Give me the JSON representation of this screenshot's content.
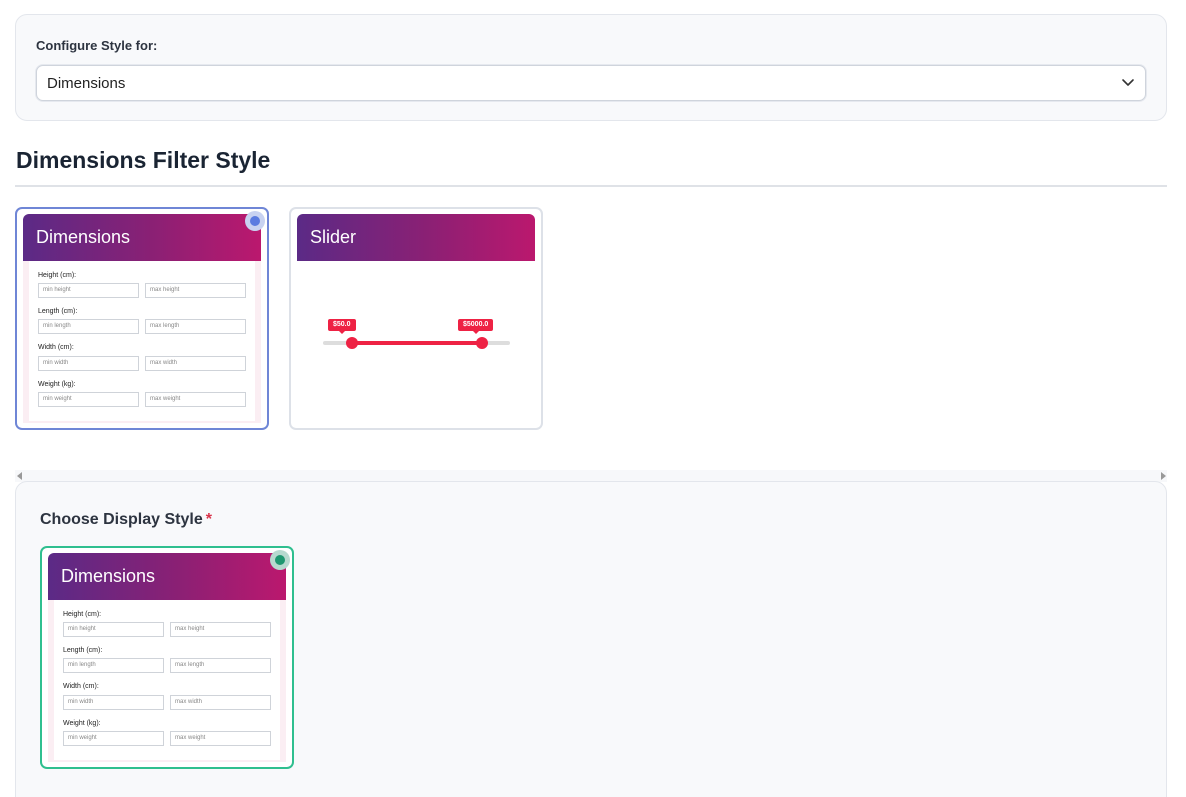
{
  "config": {
    "label": "Configure Style for:",
    "selected_value": "Dimensions"
  },
  "section": {
    "title": "Dimensions Filter Style"
  },
  "filter_styles": [
    {
      "title": "Dimensions",
      "fields": [
        {
          "label": "Height (cm):",
          "min": "min height",
          "max": "max height"
        },
        {
          "label": "Length (cm):",
          "min": "min length",
          "max": "max length"
        },
        {
          "label": "Width (cm):",
          "min": "min width",
          "max": "max width"
        },
        {
          "label": "Weight (kg):",
          "min": "min weight",
          "max": "max weight"
        }
      ]
    },
    {
      "title": "Slider",
      "min_tag": "$50.0",
      "max_tag": "$5000.0"
    }
  ],
  "display": {
    "title": "Choose Display Style",
    "required_mark": "*",
    "card": {
      "title": "Dimensions",
      "fields": [
        {
          "label": "Height (cm):",
          "min": "min height",
          "max": "max height"
        },
        {
          "label": "Length (cm):",
          "min": "min length",
          "max": "max length"
        },
        {
          "label": "Width (cm):",
          "min": "min width",
          "max": "max width"
        },
        {
          "label": "Weight (kg):",
          "min": "min weight",
          "max": "max weight"
        }
      ]
    }
  },
  "colors": {
    "header_gradient_start": "#5b2a86",
    "header_gradient_end": "#bb186e",
    "selected_blue": "#6f86d6",
    "selected_green": "#2fbf8f",
    "slider_accent": "#ee2244"
  }
}
